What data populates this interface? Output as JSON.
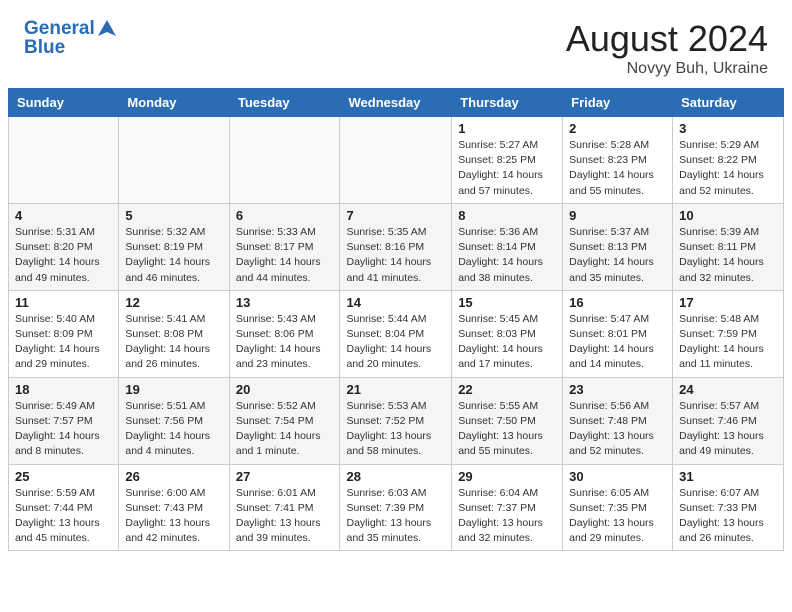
{
  "header": {
    "logo_line1": "General",
    "logo_line2": "Blue",
    "main_title": "August 2024",
    "subtitle": "Novyy Buh, Ukraine"
  },
  "days_of_week": [
    "Sunday",
    "Monday",
    "Tuesday",
    "Wednesday",
    "Thursday",
    "Friday",
    "Saturday"
  ],
  "weeks": [
    [
      {
        "day": "",
        "info": ""
      },
      {
        "day": "",
        "info": ""
      },
      {
        "day": "",
        "info": ""
      },
      {
        "day": "",
        "info": ""
      },
      {
        "day": "1",
        "info": "Sunrise: 5:27 AM\nSunset: 8:25 PM\nDaylight: 14 hours\nand 57 minutes."
      },
      {
        "day": "2",
        "info": "Sunrise: 5:28 AM\nSunset: 8:23 PM\nDaylight: 14 hours\nand 55 minutes."
      },
      {
        "day": "3",
        "info": "Sunrise: 5:29 AM\nSunset: 8:22 PM\nDaylight: 14 hours\nand 52 minutes."
      }
    ],
    [
      {
        "day": "4",
        "info": "Sunrise: 5:31 AM\nSunset: 8:20 PM\nDaylight: 14 hours\nand 49 minutes."
      },
      {
        "day": "5",
        "info": "Sunrise: 5:32 AM\nSunset: 8:19 PM\nDaylight: 14 hours\nand 46 minutes."
      },
      {
        "day": "6",
        "info": "Sunrise: 5:33 AM\nSunset: 8:17 PM\nDaylight: 14 hours\nand 44 minutes."
      },
      {
        "day": "7",
        "info": "Sunrise: 5:35 AM\nSunset: 8:16 PM\nDaylight: 14 hours\nand 41 minutes."
      },
      {
        "day": "8",
        "info": "Sunrise: 5:36 AM\nSunset: 8:14 PM\nDaylight: 14 hours\nand 38 minutes."
      },
      {
        "day": "9",
        "info": "Sunrise: 5:37 AM\nSunset: 8:13 PM\nDaylight: 14 hours\nand 35 minutes."
      },
      {
        "day": "10",
        "info": "Sunrise: 5:39 AM\nSunset: 8:11 PM\nDaylight: 14 hours\nand 32 minutes."
      }
    ],
    [
      {
        "day": "11",
        "info": "Sunrise: 5:40 AM\nSunset: 8:09 PM\nDaylight: 14 hours\nand 29 minutes."
      },
      {
        "day": "12",
        "info": "Sunrise: 5:41 AM\nSunset: 8:08 PM\nDaylight: 14 hours\nand 26 minutes."
      },
      {
        "day": "13",
        "info": "Sunrise: 5:43 AM\nSunset: 8:06 PM\nDaylight: 14 hours\nand 23 minutes."
      },
      {
        "day": "14",
        "info": "Sunrise: 5:44 AM\nSunset: 8:04 PM\nDaylight: 14 hours\nand 20 minutes."
      },
      {
        "day": "15",
        "info": "Sunrise: 5:45 AM\nSunset: 8:03 PM\nDaylight: 14 hours\nand 17 minutes."
      },
      {
        "day": "16",
        "info": "Sunrise: 5:47 AM\nSunset: 8:01 PM\nDaylight: 14 hours\nand 14 minutes."
      },
      {
        "day": "17",
        "info": "Sunrise: 5:48 AM\nSunset: 7:59 PM\nDaylight: 14 hours\nand 11 minutes."
      }
    ],
    [
      {
        "day": "18",
        "info": "Sunrise: 5:49 AM\nSunset: 7:57 PM\nDaylight: 14 hours\nand 8 minutes."
      },
      {
        "day": "19",
        "info": "Sunrise: 5:51 AM\nSunset: 7:56 PM\nDaylight: 14 hours\nand 4 minutes."
      },
      {
        "day": "20",
        "info": "Sunrise: 5:52 AM\nSunset: 7:54 PM\nDaylight: 14 hours\nand 1 minute."
      },
      {
        "day": "21",
        "info": "Sunrise: 5:53 AM\nSunset: 7:52 PM\nDaylight: 13 hours\nand 58 minutes."
      },
      {
        "day": "22",
        "info": "Sunrise: 5:55 AM\nSunset: 7:50 PM\nDaylight: 13 hours\nand 55 minutes."
      },
      {
        "day": "23",
        "info": "Sunrise: 5:56 AM\nSunset: 7:48 PM\nDaylight: 13 hours\nand 52 minutes."
      },
      {
        "day": "24",
        "info": "Sunrise: 5:57 AM\nSunset: 7:46 PM\nDaylight: 13 hours\nand 49 minutes."
      }
    ],
    [
      {
        "day": "25",
        "info": "Sunrise: 5:59 AM\nSunset: 7:44 PM\nDaylight: 13 hours\nand 45 minutes."
      },
      {
        "day": "26",
        "info": "Sunrise: 6:00 AM\nSunset: 7:43 PM\nDaylight: 13 hours\nand 42 minutes."
      },
      {
        "day": "27",
        "info": "Sunrise: 6:01 AM\nSunset: 7:41 PM\nDaylight: 13 hours\nand 39 minutes."
      },
      {
        "day": "28",
        "info": "Sunrise: 6:03 AM\nSunset: 7:39 PM\nDaylight: 13 hours\nand 35 minutes."
      },
      {
        "day": "29",
        "info": "Sunrise: 6:04 AM\nSunset: 7:37 PM\nDaylight: 13 hours\nand 32 minutes."
      },
      {
        "day": "30",
        "info": "Sunrise: 6:05 AM\nSunset: 7:35 PM\nDaylight: 13 hours\nand 29 minutes."
      },
      {
        "day": "31",
        "info": "Sunrise: 6:07 AM\nSunset: 7:33 PM\nDaylight: 13 hours\nand 26 minutes."
      }
    ]
  ]
}
